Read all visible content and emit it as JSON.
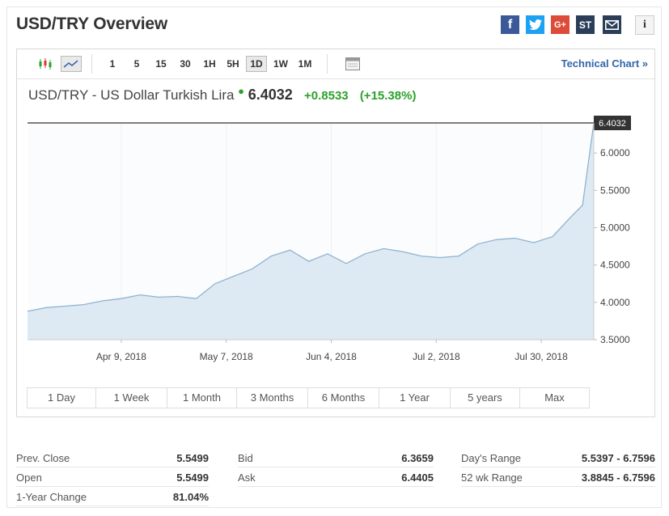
{
  "header": {
    "title": "USD/TRY Overview"
  },
  "share_icons": [
    "facebook-icon",
    "twitter-icon",
    "google-plus-icon",
    "stocktwits-icon",
    "mail-icon",
    "info-icon"
  ],
  "toolbar": {
    "intervals": [
      "1",
      "5",
      "15",
      "30",
      "1H",
      "5H",
      "1D",
      "1W",
      "1M"
    ],
    "active_interval": "1D",
    "technical_chart": "Technical Chart »"
  },
  "quote": {
    "name": "USD/TRY - US Dollar Turkish Lira",
    "last": "6.4032",
    "change": "+0.8533",
    "change_pct": "(+15.38%)"
  },
  "colors": {
    "up": "#2ba12b",
    "area": "#dde9f3",
    "line": "#8fb3d2",
    "link": "#3466a8"
  },
  "chart_data": {
    "type": "area",
    "x": [
      "2018-03-15",
      "2018-03-20",
      "2018-03-25",
      "2018-03-30",
      "2018-04-04",
      "2018-04-09",
      "2018-04-14",
      "2018-04-19",
      "2018-04-24",
      "2018-04-29",
      "2018-05-04",
      "2018-05-09",
      "2018-05-14",
      "2018-05-19",
      "2018-05-24",
      "2018-05-29",
      "2018-06-03",
      "2018-06-08",
      "2018-06-13",
      "2018-06-18",
      "2018-06-23",
      "2018-06-28",
      "2018-07-03",
      "2018-07-08",
      "2018-07-13",
      "2018-07-18",
      "2018-07-23",
      "2018-07-28",
      "2018-08-02",
      "2018-08-07",
      "2018-08-10",
      "2018-08-13"
    ],
    "y": [
      3.88,
      3.93,
      3.95,
      3.97,
      4.02,
      4.05,
      4.1,
      4.07,
      4.08,
      4.05,
      4.25,
      4.35,
      4.45,
      4.62,
      4.7,
      4.55,
      4.65,
      4.52,
      4.65,
      4.72,
      4.68,
      4.62,
      4.6,
      4.62,
      4.78,
      4.84,
      4.86,
      4.8,
      4.88,
      5.15,
      5.3,
      6.4
    ],
    "xticks": [
      "Apr 9, 2018",
      "May 7, 2018",
      "Jun 4, 2018",
      "Jul 2, 2018",
      "Jul 30, 2018"
    ],
    "xtick_dates": [
      "2018-04-09",
      "2018-05-07",
      "2018-06-04",
      "2018-07-02",
      "2018-07-30"
    ],
    "yticks": [
      "6.0000",
      "5.5000",
      "5.0000",
      "4.5000",
      "4.0000",
      "3.5000"
    ],
    "ytick_values": [
      6.0,
      5.5,
      5.0,
      4.5,
      4.0,
      3.5
    ],
    "last_label": "6.4032",
    "last_value": 6.4032,
    "ylim": [
      3.5,
      6.4032
    ]
  },
  "ranges": [
    "1 Day",
    "1 Week",
    "1 Month",
    "3 Months",
    "6 Months",
    "1 Year",
    "5 years",
    "Max"
  ],
  "stats": [
    {
      "label": "Prev. Close",
      "value": "5.5499"
    },
    {
      "label": "Bid",
      "value": "6.3659"
    },
    {
      "label": "Day's Range",
      "value": "5.5397 - 6.7596"
    },
    {
      "label": "Open",
      "value": "5.5499"
    },
    {
      "label": "Ask",
      "value": "6.4405"
    },
    {
      "label": "52 wk Range",
      "value": "3.8845 - 6.7596"
    },
    {
      "label": "1-Year Change",
      "value": "81.04%"
    }
  ]
}
